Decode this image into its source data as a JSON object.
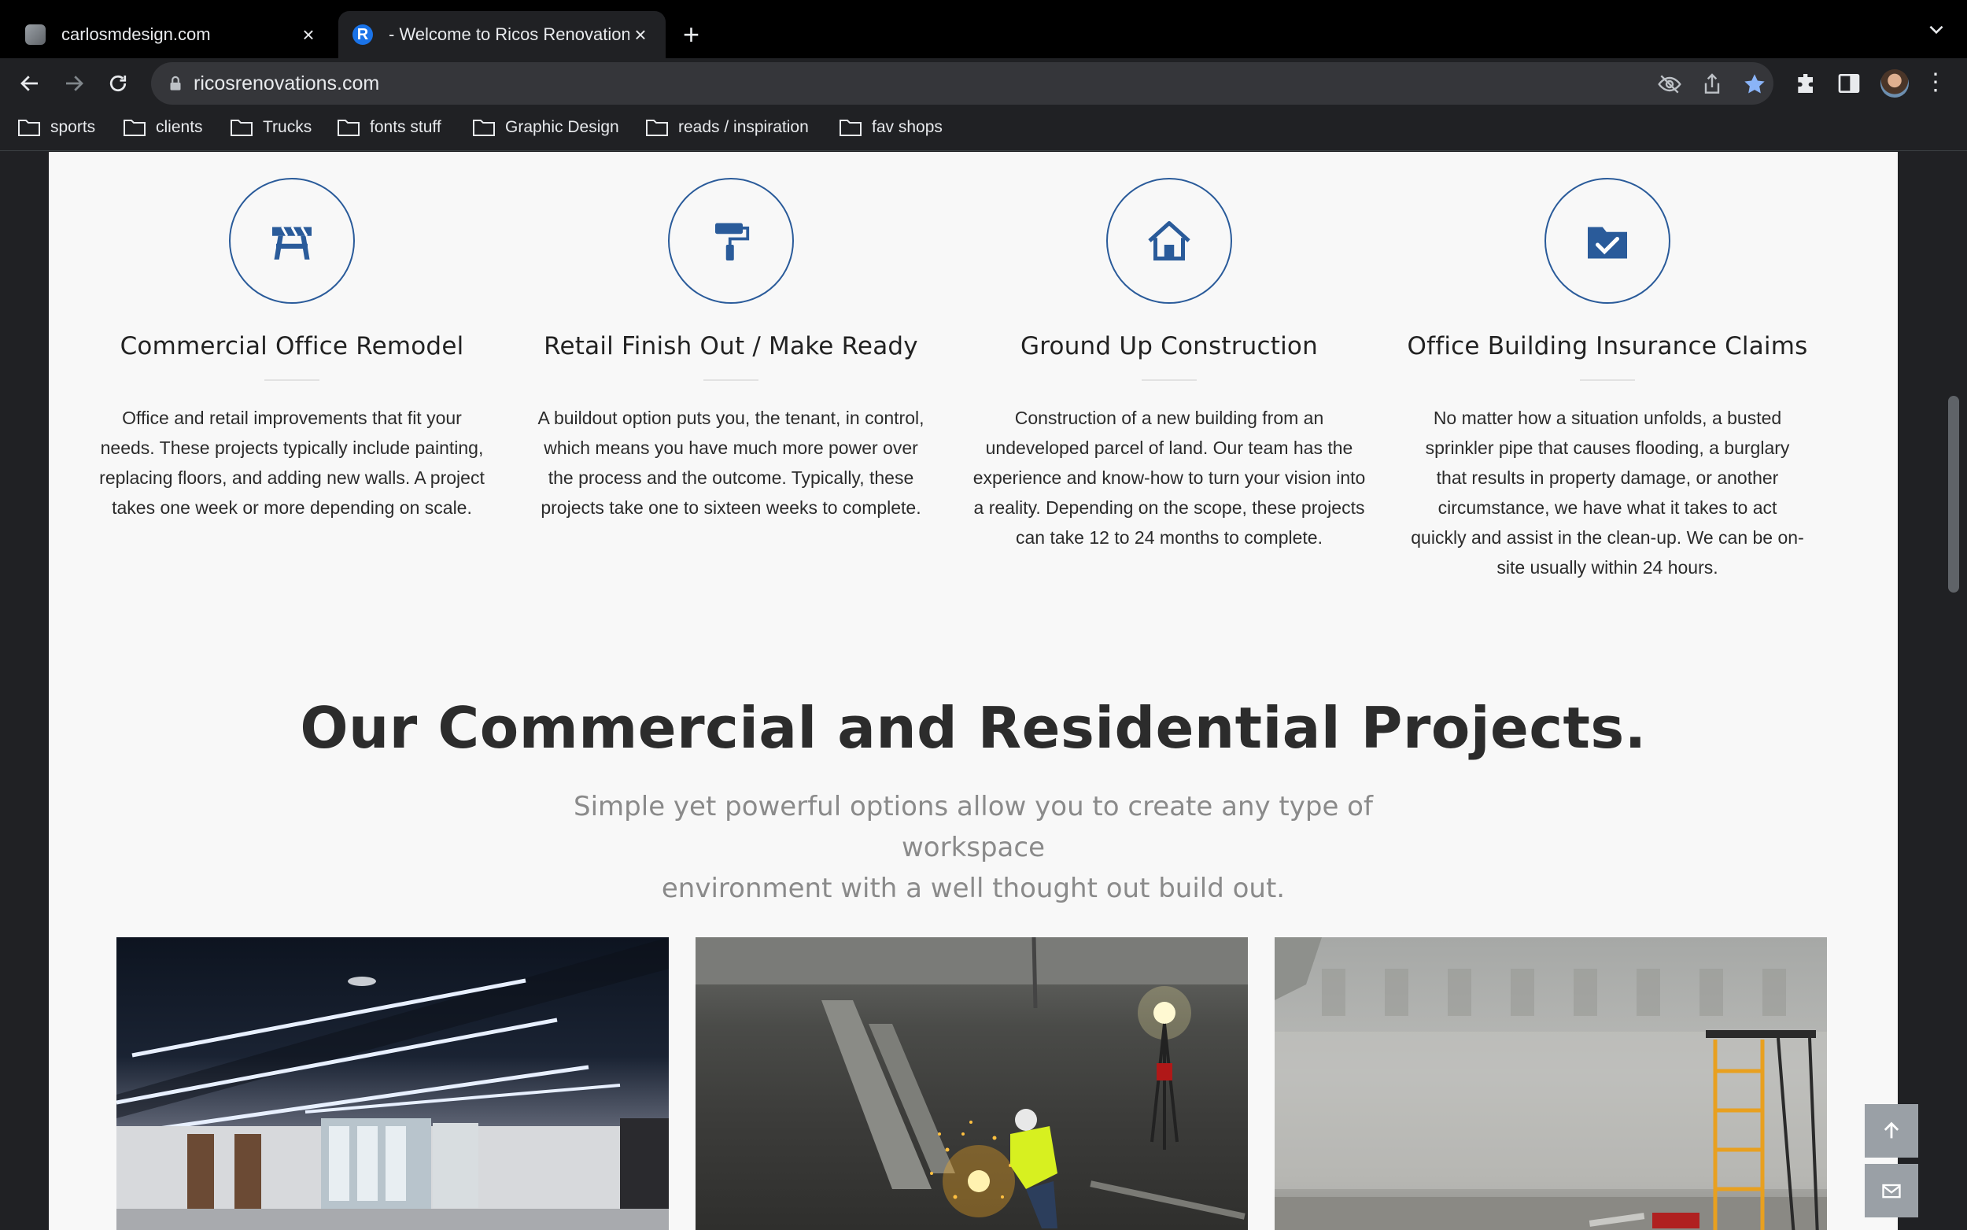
{
  "browser": {
    "tabs": [
      {
        "title": "carlosmdesign.com",
        "icon": "cube-icon",
        "active": false
      },
      {
        "title": "- Welcome to Ricos Renovation",
        "icon": "r-logo-icon",
        "active": true
      }
    ],
    "new_tab": "+",
    "url": "ricosrenovations.com",
    "bookmarks": [
      "sports",
      "clients",
      "Trucks",
      "fonts stuff",
      "Graphic Design",
      "reads / inspiration",
      "fav shops"
    ],
    "accent": "#8ab4f8"
  },
  "services": [
    {
      "icon": "sawhorse-barrier-icon",
      "title": "Commercial Office Remodel",
      "lines": [
        "Office and retail improvements that fit your",
        "needs. These projects typically include painting,",
        "replacing floors, and adding new walls. A project",
        "takes one week or more depending on scale."
      ]
    },
    {
      "icon": "paint-roller-icon",
      "title": "Retail Finish Out / Make Ready",
      "lines": [
        "A buildout option puts you, the tenant, in control,",
        "which means you have much more power over",
        "the process and the outcome. Typically, these",
        "projects take one to sixteen weeks to complete."
      ]
    },
    {
      "icon": "house-icon",
      "title": "Ground Up Construction",
      "lines": [
        "Construction of a new building from an",
        "undeveloped parcel of land. Our team has the",
        "experience and know-how to turn your vision into",
        "a reality. Depending on the scope, these projects",
        "can take 12 to 24 months to complete."
      ]
    },
    {
      "icon": "folder-check-icon",
      "title": "Office Building Insurance Claims",
      "lines": [
        "No matter how a situation unfolds, a busted",
        "sprinkler pipe that causes flooding, a burglary",
        "that results in property damage, or another",
        "circumstance, we have what it takes to act",
        "quickly and assist in the clean-up. We can be on-",
        "site usually within 24 hours."
      ]
    }
  ],
  "projects": {
    "title": "Our Commercial and Residential Projects.",
    "subtitle_lines": [
      "Simple yet powerful options allow you to create any type of workspace",
      "environment with a well thought out build out."
    ]
  },
  "brand_color": "#2a5b9a",
  "float_buttons": [
    {
      "icon": "arrow-up-icon",
      "symbol": "↑"
    },
    {
      "icon": "mail-icon",
      "symbol": "✉"
    }
  ]
}
